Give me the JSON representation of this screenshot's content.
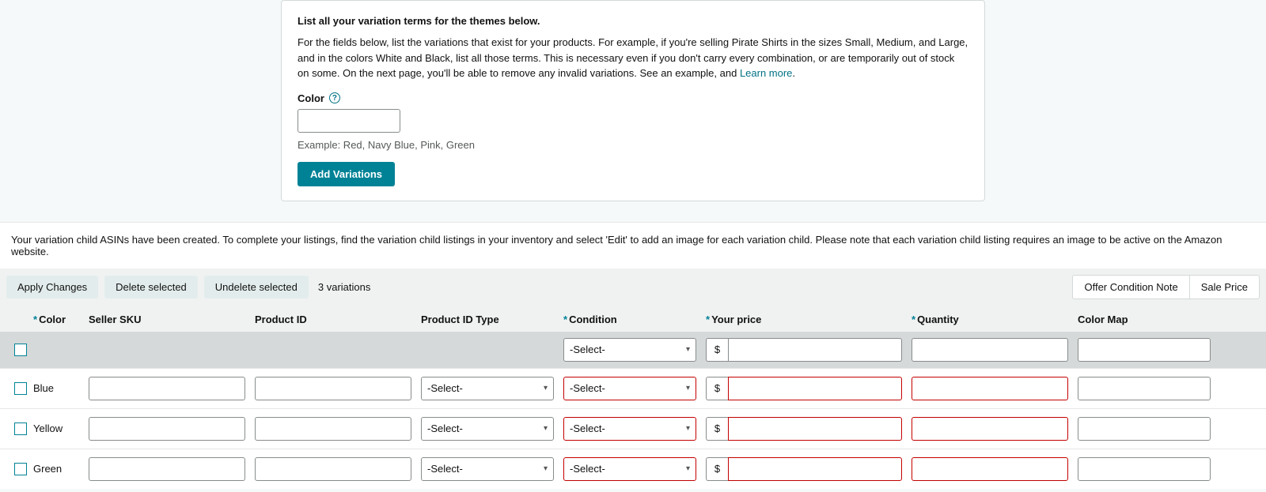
{
  "panel": {
    "heading": "List all your variation terms for the themes below.",
    "description_prefix": "For the fields below, list the variations that exist for your products. For example, if you're selling Pirate Shirts in the sizes Small, Medium, and Large, and in the colors White and Black, list all those terms. This is necessary even if you don't carry every combination, or are temporarily out of stock on some. On the next page, you'll be able to remove any invalid variations. See an example, and ",
    "learn_more": "Learn more",
    "description_suffix": ".",
    "color_label": "Color",
    "example": "Example: Red, Navy Blue, Pink, Green",
    "add_button": "Add Variations"
  },
  "info_banner": "Your variation child ASINs have been created. To complete your listings, find the variation child listings in your inventory and select 'Edit' to add an image for each variation child. Please note that each variation child listing requires an image to be active on the Amazon website.",
  "toolbar": {
    "apply": "Apply Changes",
    "delete": "Delete selected",
    "undelete": "Undelete selected",
    "count": "3 variations",
    "offer_note": "Offer Condition Note",
    "sale_price": "Sale Price"
  },
  "columns": {
    "color": "Color",
    "sku": "Seller SKU",
    "product_id": "Product ID",
    "product_id_type": "Product ID Type",
    "condition": "Condition",
    "price": "Your price",
    "quantity": "Quantity",
    "color_map": "Color Map"
  },
  "select_placeholder": "-Select-",
  "currency": "$",
  "rows": [
    {
      "color": "Blue"
    },
    {
      "color": "Yellow"
    },
    {
      "color": "Green"
    }
  ]
}
